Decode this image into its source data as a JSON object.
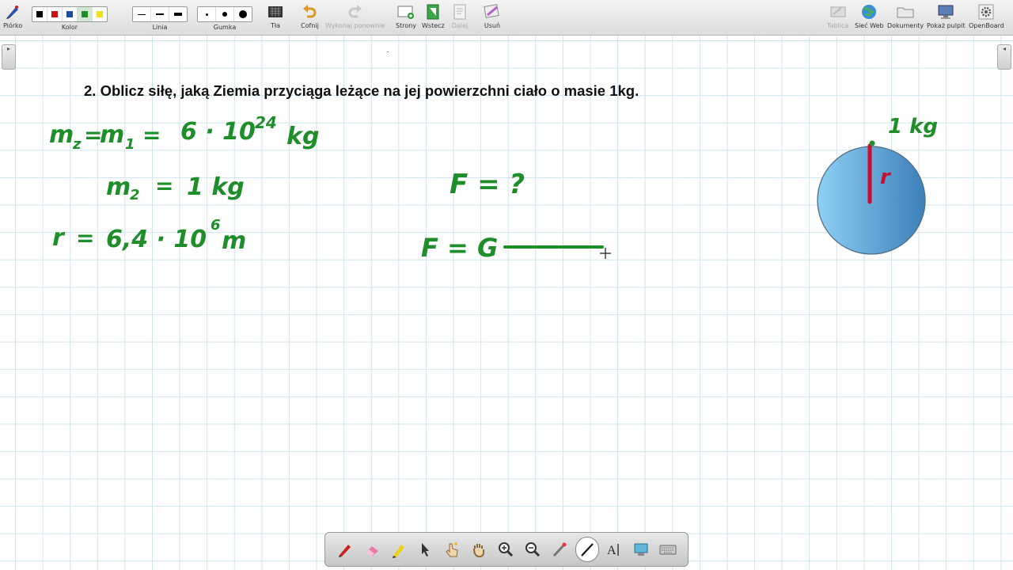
{
  "toolbar": {
    "pen_label": "Piórko",
    "color_label": "Kolor",
    "line_label": "Linia",
    "eraser_label": "Gumka",
    "backgrounds_label": "Tła",
    "undo_label": "Cofnij",
    "redo_label": "Wykonaj ponownie",
    "pages_label": "Strony",
    "back_label": "Wstecz",
    "next_label": "Dalej",
    "delete_label": "Usuń",
    "board_label": "Tablica",
    "web_label": "Sieć Web",
    "documents_label": "Dokumenty",
    "desktop_label": "Pokaż pulpit",
    "openboard_label": "OpenBoard",
    "colors": [
      "#000000",
      "#d01010",
      "#1a4fa0",
      "#1f8d2a",
      "#f0e020"
    ]
  },
  "board": {
    "question": "2. Oblicz siłę, jaką Ziemia przyciąga leżące na jej powierzchni ciało o masie 1kg.",
    "notes": {
      "m1_left": "m",
      "m1_sub": "z",
      "m1_eq": "=",
      "m1_m": "m",
      "m1_sub2": "1",
      "m1_eq2": "=",
      "m1_val": "6 · 10",
      "m1_exp": "24",
      "m1_unit": "kg",
      "m2_m": "m",
      "m2_sub": "2",
      "m2_eq": "=",
      "m2_val": "1 kg",
      "r_sym": "r",
      "r_eq": "=",
      "r_val": "6,4 · 10",
      "r_exp": "6",
      "r_unit": "m",
      "f_q": "F = ?",
      "f_eq": "F = G"
    },
    "earth": {
      "label": "1 kg",
      "radius_label": "r",
      "fill_light": "#8fd0f5",
      "fill_dark": "#3d7fb9",
      "radius_color": "#c8102e"
    }
  },
  "colors": {
    "ink_green": "#1f8d2a",
    "grid": "#cfe5ef"
  }
}
